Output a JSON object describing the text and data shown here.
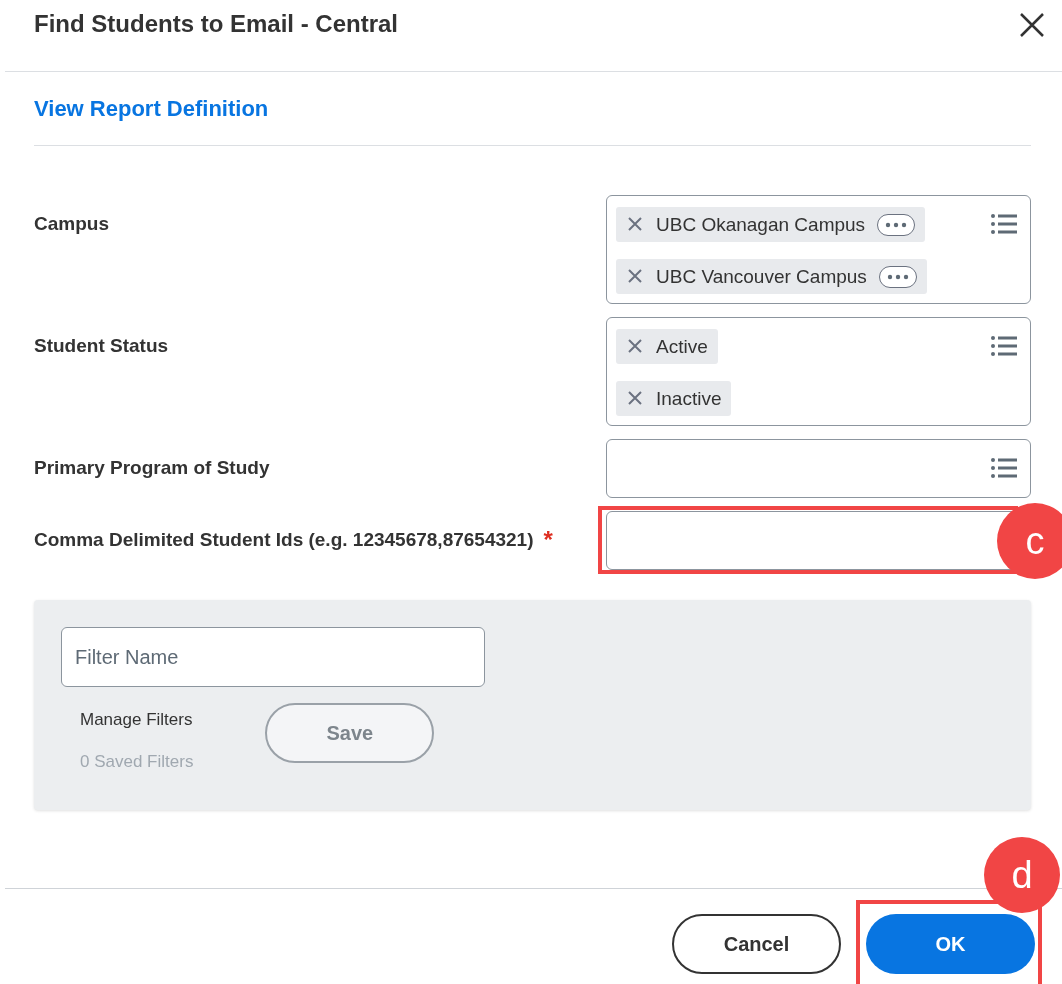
{
  "dialog": {
    "title": "Find Students to Email - Central",
    "link": "View Report Definition",
    "fields": [
      {
        "label": "Campus",
        "kind": "multiselect",
        "chips": [
          {
            "text": "UBC Okanagan Campus",
            "kind": "menu"
          },
          {
            "text": "UBC Vancouver Campus",
            "kind": "menu"
          }
        ]
      },
      {
        "label": "Student Status",
        "kind": "multiselect",
        "chips": [
          {
            "text": "Active",
            "kind": "plain"
          },
          {
            "text": "Inactive",
            "kind": "plain"
          }
        ]
      },
      {
        "label": "Primary Program of Study",
        "kind": "multiselect"
      },
      {
        "label": "Comma Delimited Student Ids (e.g. 12345678,87654321)",
        "kind": "text",
        "required_mark": "*",
        "callout": "c"
      }
    ],
    "filter_panel": {
      "placeholder": "Filter Name",
      "manage_label": "Manage Filters",
      "saved_count": "0 Saved Filters",
      "save_button": "Save"
    },
    "buttons": [
      {
        "label": "Cancel",
        "kind": "secondary"
      },
      {
        "label": "OK",
        "kind": "primary",
        "callout": "d"
      }
    ]
  }
}
